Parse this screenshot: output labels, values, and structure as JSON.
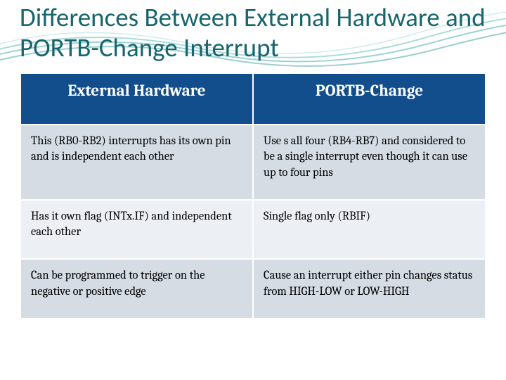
{
  "title": "Differences Between External Hardware and PORTB-Change Interrupt",
  "table": {
    "headers": [
      "External Hardware",
      "PORTB-Change"
    ],
    "rows": [
      {
        "c1": "This (RB0-RB2) interrupts has its own pin and is independent each other",
        "c2": "Use s all four (RB4-RB7) and considered to be a single interrupt even though it can use up to four pins"
      },
      {
        "c1": "Has it own flag (INTx.IF) and independent each other",
        "c2": "Single flag only (RBIF)"
      },
      {
        "c1": "Can be programmed to trigger on the negative or positive edge",
        "c2": "Cause an interrupt either pin changes status from HIGH-LOW or LOW-HIGH"
      }
    ]
  }
}
